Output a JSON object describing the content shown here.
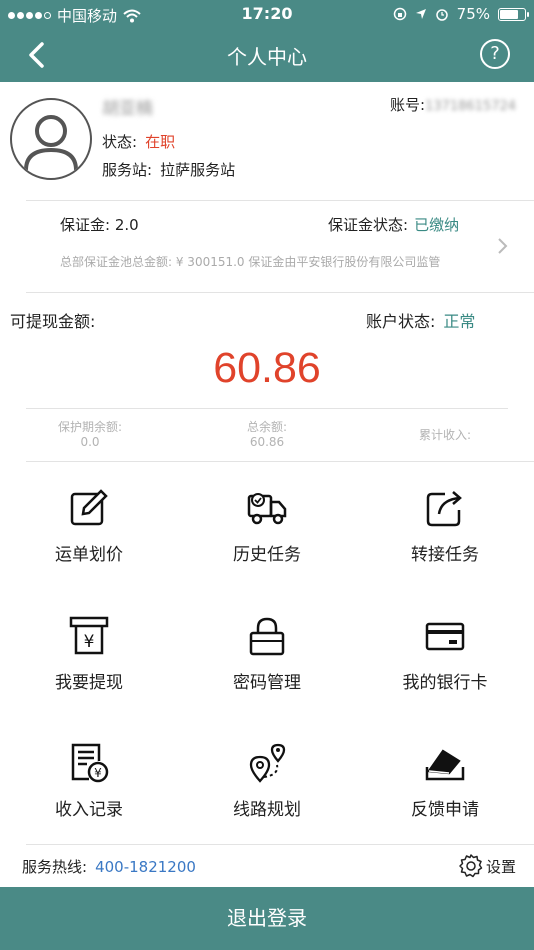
{
  "status_bar": {
    "carrier": "中国移动",
    "time": "17:20",
    "battery": "75%",
    "battery_level": 0.75
  },
  "nav": {
    "title": "个人中心"
  },
  "profile": {
    "name": "胡亚楠",
    "account_label": "账号:",
    "account_value": "13718615724",
    "status_label": "状态:",
    "status_value": "在职",
    "station_label": "服务站:",
    "station_value": "拉萨服务站"
  },
  "deposit": {
    "amount_label": "保证金:",
    "amount_value": "2.0",
    "status_label": "保证金状态:",
    "status_value": "已缴纳",
    "note": "总部保证金池总金额: ¥ 300151.0 保证金由平安银行股份有限公司监管"
  },
  "balance": {
    "withdrawable_label": "可提现金额:",
    "account_status_label": "账户状态:",
    "account_status_value": "正常",
    "amount": "60.86",
    "stats": [
      {
        "label": "保护期余额:",
        "value": "0.0"
      },
      {
        "label": "总余额:",
        "value": "60.86"
      },
      {
        "label": "累计收入:",
        "value": ""
      }
    ]
  },
  "menu": [
    {
      "label": "运单划价",
      "icon": "edit-icon"
    },
    {
      "label": "历史任务",
      "icon": "truck-icon"
    },
    {
      "label": "转接任务",
      "icon": "share-icon"
    },
    {
      "label": "我要提现",
      "icon": "withdraw-icon"
    },
    {
      "label": "密码管理",
      "icon": "lock-icon"
    },
    {
      "label": "我的银行卡",
      "icon": "bank-card-icon"
    },
    {
      "label": "收入记录",
      "icon": "income-record-icon"
    },
    {
      "label": "线路规划",
      "icon": "route-icon"
    },
    {
      "label": "反馈申请",
      "icon": "feedback-icon"
    }
  ],
  "footer": {
    "hotline_label": "服务热线:",
    "hotline_value": "400-1821200",
    "settings_label": "设置",
    "logout_label": "退出登录"
  },
  "colors": {
    "primary": "#4a8a86",
    "accent_red": "#e0432b",
    "accent_teal": "#3a8a84",
    "link_blue": "#3a78c4"
  }
}
